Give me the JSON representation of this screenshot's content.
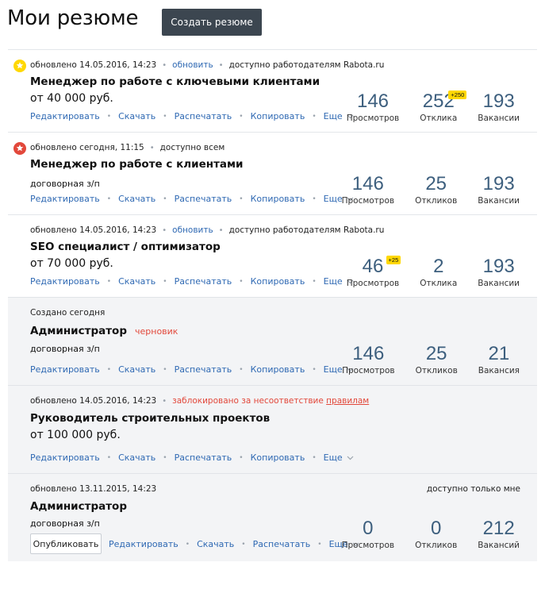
{
  "header": {
    "title": "Мои резюме",
    "create_label": "Создать резюме"
  },
  "colors": {
    "link": "#2f69b3",
    "warning": "#e2483b",
    "badge_yellow": "#ffd800",
    "stat_number": "#3d5f7e",
    "button_dark": "#3c4650",
    "card_gray": "#f3f4f6"
  },
  "labels": {
    "edit": "Редактировать",
    "download": "Скачать",
    "print": "Распечатать",
    "copy": "Копировать",
    "more": "Еще",
    "publish": "Опубликовать"
  },
  "resumes": [
    {
      "icon": "star-yellow-icon",
      "updated": "обновлено 14.05.2016, 14:23",
      "refresh": "обновить",
      "access": "доступно работодателям Rabota.ru",
      "title": "Менеджер по работе с ключевыми клиентами",
      "salary": "от 40 000 руб.",
      "stats": [
        {
          "value": "146",
          "label": "Просмотров",
          "badge": ""
        },
        {
          "value": "252",
          "label": "Отклика",
          "badge": "+250"
        },
        {
          "value": "193",
          "label": "Вакансии",
          "badge": ""
        }
      ]
    },
    {
      "icon": "star-red-icon",
      "updated": "обновлено сегодня, 11:15",
      "access": "доступно всем",
      "title": "Менеджер по работе с клиентами",
      "salary": "договорная з/п",
      "stats": [
        {
          "value": "146",
          "label": "Просмотров"
        },
        {
          "value": "25",
          "label": "Откликов"
        },
        {
          "value": "193",
          "label": "Вакансии"
        }
      ]
    },
    {
      "updated": "обновлено 14.05.2016, 14:23",
      "refresh": "обновить",
      "access": "доступно работодателям Rabota.ru",
      "title": "SEO специалист / оптимизатор",
      "salary": "от 70 000 руб.",
      "stats": [
        {
          "value": "46",
          "label": "Просмотров",
          "badge": "+25"
        },
        {
          "value": "2",
          "label": "Отклика"
        },
        {
          "value": "193",
          "label": "Вакансии"
        }
      ]
    },
    {
      "created": "Создано сегодня",
      "title": "Администратор",
      "status": "черновик",
      "salary": "договорная з/п",
      "stats": [
        {
          "value": "146",
          "label": "Просмотров"
        },
        {
          "value": "25",
          "label": "Откликов"
        },
        {
          "value": "21",
          "label": "Вакансия"
        }
      ]
    },
    {
      "updated": "обновлено 14.05.2016, 14:23",
      "blocked": "заблокировано за несоответствие",
      "rules": "правилам",
      "title": "Руководитель строительных проектов",
      "salary": "от 100 000 руб."
    },
    {
      "updated": "обновлено 13.11.2015, 14:23",
      "access": "доступно только мне",
      "title": "Администратор",
      "salary": "договорная з/п",
      "stats": [
        {
          "value": "0",
          "label": "Просмотров"
        },
        {
          "value": "0",
          "label": "Откликов"
        },
        {
          "value": "212",
          "label": "Вакансий"
        }
      ]
    }
  ]
}
